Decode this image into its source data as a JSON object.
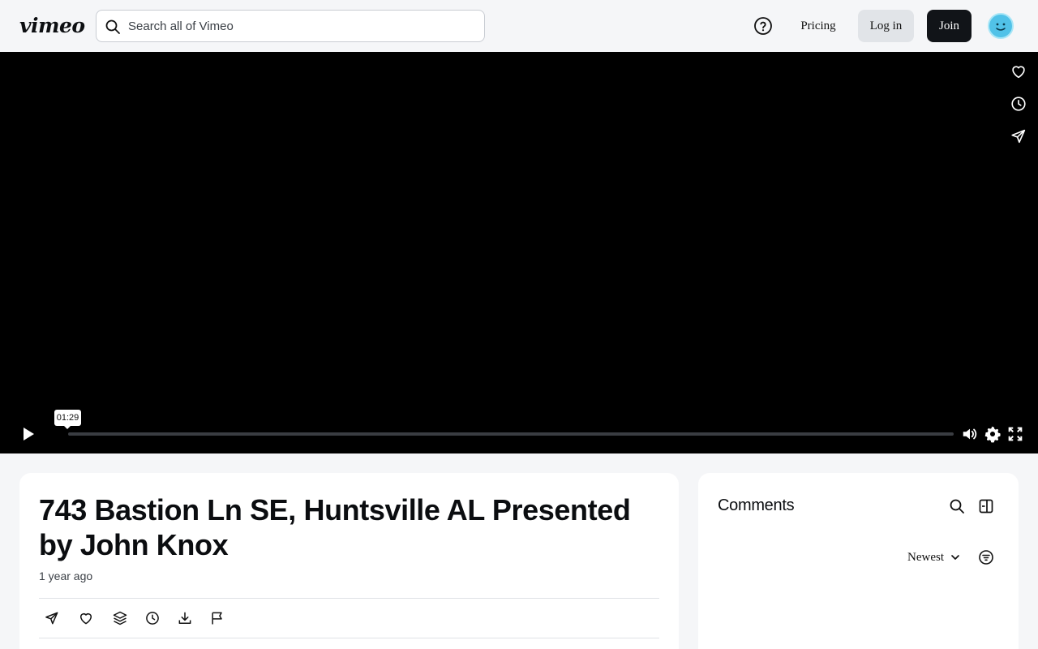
{
  "header": {
    "logo": "vimeo",
    "search_placeholder": "Search all of Vimeo",
    "pricing_label": "Pricing",
    "login_label": "Log in",
    "join_label": "Join"
  },
  "player": {
    "hover_time": "01:29",
    "progress": 0.0
  },
  "video": {
    "title": "743 Bastion Ln SE, Huntsville AL Presented by John Knox",
    "age": "1 year ago"
  },
  "comments": {
    "title": "Comments",
    "sort_label": "Newest"
  },
  "colors": {
    "accent_dark": "#111418",
    "avatar": "#51c2e8",
    "page_bg": "#f5f6f8"
  }
}
